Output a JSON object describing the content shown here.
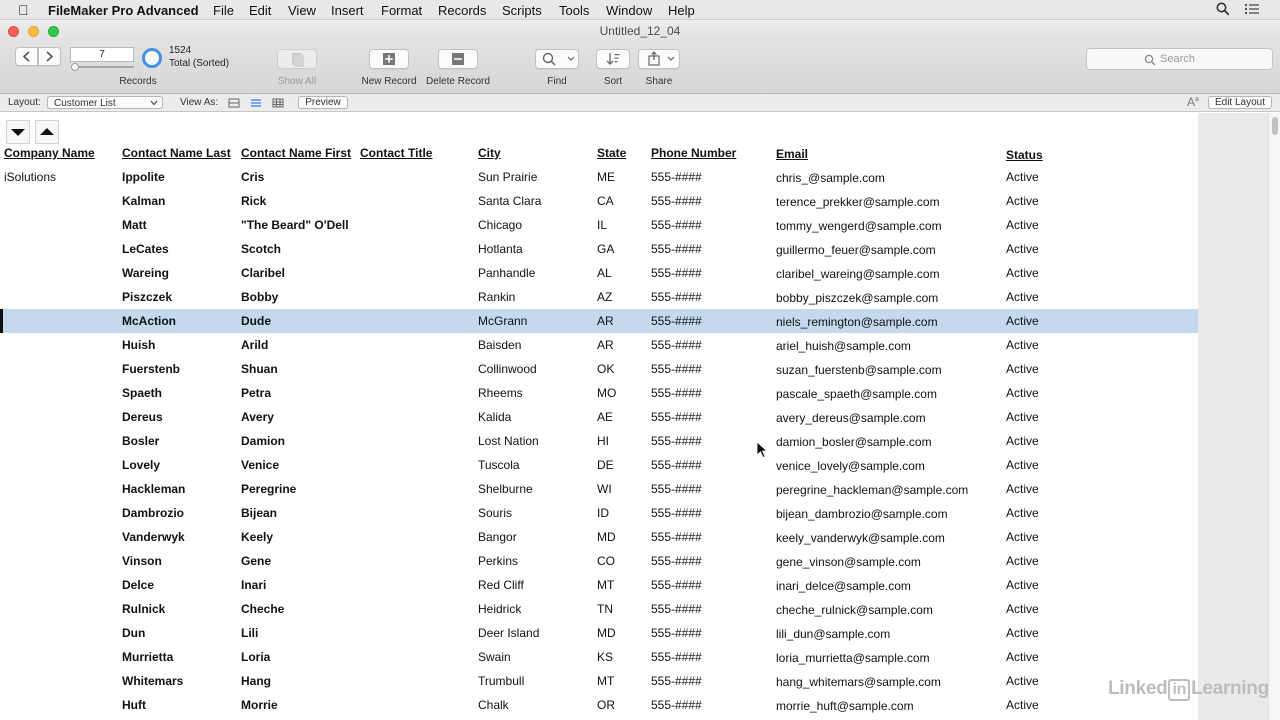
{
  "menubar": {
    "app_name": "FileMaker Pro Advanced",
    "items": [
      "File",
      "Edit",
      "View",
      "Insert",
      "Format",
      "Records",
      "Scripts",
      "Tools",
      "Window",
      "Help"
    ]
  },
  "window": {
    "title": "Untitled_12_04"
  },
  "toolbar": {
    "record_value": "7",
    "record_count": "1524",
    "record_status": "Total (Sorted)",
    "records_label": "Records",
    "show_all_label": "Show All",
    "new_record_label": "New Record",
    "delete_record_label": "Delete Record",
    "find_label": "Find",
    "sort_label": "Sort",
    "share_label": "Share",
    "search_placeholder": "Search"
  },
  "layoutbar": {
    "layout_label": "Layout:",
    "layout_value": "Customer List",
    "view_as_label": "View As:",
    "preview_label": "Preview",
    "edit_layout_label": "Edit Layout"
  },
  "table": {
    "columns": [
      {
        "key": "company",
        "label": "Company Name"
      },
      {
        "key": "last",
        "label": "Contact Name Last"
      },
      {
        "key": "first",
        "label": "Contact Name First"
      },
      {
        "key": "title",
        "label": "Contact Title"
      },
      {
        "key": "city",
        "label": "City"
      },
      {
        "key": "state",
        "label": "State"
      },
      {
        "key": "phone",
        "label": "Phone Number"
      },
      {
        "key": "email",
        "label": "Email"
      },
      {
        "key": "status",
        "label": "Status"
      }
    ],
    "selected_index": 6,
    "rows": [
      {
        "company": "iSolutions",
        "last": "Ippolite",
        "first": "Cris",
        "title": "",
        "city": "Sun Prairie",
        "state": "ME",
        "phone": "555-####",
        "email": "chris_@sample.com",
        "status": "Active"
      },
      {
        "company": "",
        "last": "Kalman",
        "first": "Rick",
        "title": "",
        "city": "Santa Clara",
        "state": "CA",
        "phone": "555-####",
        "email": "terence_prekker@sample.com",
        "status": "Active"
      },
      {
        "company": "",
        "last": "Matt",
        "first": "\"The Beard\" O'Dell",
        "title": "",
        "city": "Chicago",
        "state": "IL",
        "phone": "555-####",
        "email": "tommy_wengerd@sample.com",
        "status": "Active"
      },
      {
        "company": "",
        "last": "LeCates",
        "first": "Scotch",
        "title": "",
        "city": "Hotlanta",
        "state": "GA",
        "phone": "555-####",
        "email": "guillermo_feuer@sample.com",
        "status": "Active"
      },
      {
        "company": "",
        "last": "Wareing",
        "first": "Claribel",
        "title": "",
        "city": "Panhandle",
        "state": "AL",
        "phone": "555-####",
        "email": "claribel_wareing@sample.com",
        "status": "Active"
      },
      {
        "company": "",
        "last": "Piszczek",
        "first": "Bobby",
        "title": "",
        "city": "Rankin",
        "state": "AZ",
        "phone": "555-####",
        "email": "bobby_piszczek@sample.com",
        "status": "Active"
      },
      {
        "company": "",
        "last": "McAction",
        "first": "Dude",
        "title": "",
        "city": "McGrann",
        "state": "AR",
        "phone": "555-####",
        "email": "niels_remington@sample.com",
        "status": "Active"
      },
      {
        "company": "",
        "last": "Huish",
        "first": "Arild",
        "title": "",
        "city": "Baisden",
        "state": "AR",
        "phone": "555-####",
        "email": "ariel_huish@sample.com",
        "status": "Active"
      },
      {
        "company": "",
        "last": "Fuerstenb",
        "first": "Shuan",
        "title": "",
        "city": "Collinwood",
        "state": "OK",
        "phone": "555-####",
        "email": "suzan_fuerstenb@sample.com",
        "status": "Active"
      },
      {
        "company": "",
        "last": "Spaeth",
        "first": "Petra",
        "title": "",
        "city": "Rheems",
        "state": "MO",
        "phone": "555-####",
        "email": "pascale_spaeth@sample.com",
        "status": "Active"
      },
      {
        "company": "",
        "last": "Dereus",
        "first": "Avery",
        "title": "",
        "city": "Kalida",
        "state": "AE",
        "phone": "555-####",
        "email": "avery_dereus@sample.com",
        "status": "Active"
      },
      {
        "company": "",
        "last": "Bosler",
        "first": "Damion",
        "title": "",
        "city": "Lost Nation",
        "state": "HI",
        "phone": "555-####",
        "email": "damion_bosler@sample.com",
        "status": "Active"
      },
      {
        "company": "",
        "last": "Lovely",
        "first": "Venice",
        "title": "",
        "city": "Tuscola",
        "state": "DE",
        "phone": "555-####",
        "email": "venice_lovely@sample.com",
        "status": "Active"
      },
      {
        "company": "",
        "last": "Hackleman",
        "first": "Peregrine",
        "title": "",
        "city": "Shelburne",
        "state": "WI",
        "phone": "555-####",
        "email": "peregrine_hackleman@sample.com",
        "status": "Active"
      },
      {
        "company": "",
        "last": "Dambrozio",
        "first": "Bijean",
        "title": "",
        "city": "Souris",
        "state": "ID",
        "phone": "555-####",
        "email": "bijean_dambrozio@sample.com",
        "status": "Active"
      },
      {
        "company": "",
        "last": "Vanderwyk",
        "first": "Keely",
        "title": "",
        "city": "Bangor",
        "state": "MD",
        "phone": "555-####",
        "email": "keely_vanderwyk@sample.com",
        "status": "Active"
      },
      {
        "company": "",
        "last": "Vinson",
        "first": "Gene",
        "title": "",
        "city": "Perkins",
        "state": "CO",
        "phone": "555-####",
        "email": "gene_vinson@sample.com",
        "status": "Active"
      },
      {
        "company": "",
        "last": "Delce",
        "first": "Inari",
        "title": "",
        "city": "Red Cliff",
        "state": "MT",
        "phone": "555-####",
        "email": "inari_delce@sample.com",
        "status": "Active"
      },
      {
        "company": "",
        "last": "Rulnick",
        "first": "Cheche",
        "title": "",
        "city": "Heidrick",
        "state": "TN",
        "phone": "555-####",
        "email": "cheche_rulnick@sample.com",
        "status": "Active"
      },
      {
        "company": "",
        "last": "Dun",
        "first": "Lili",
        "title": "",
        "city": "Deer Island",
        "state": "MD",
        "phone": "555-####",
        "email": "lili_dun@sample.com",
        "status": "Active"
      },
      {
        "company": "",
        "last": "Murrietta",
        "first": "Loria",
        "title": "",
        "city": "Swain",
        "state": "KS",
        "phone": "555-####",
        "email": "loria_murrietta@sample.com",
        "status": "Active"
      },
      {
        "company": "",
        "last": "Whitemars",
        "first": "Hang",
        "title": "",
        "city": "Trumbull",
        "state": "MT",
        "phone": "555-####",
        "email": "hang_whitemars@sample.com",
        "status": "Active"
      },
      {
        "company": "",
        "last": "Huft",
        "first": "Morrie",
        "title": "",
        "city": "Chalk",
        "state": "OR",
        "phone": "555-####",
        "email": "morrie_huft@sample.com",
        "status": "Active"
      }
    ]
  },
  "watermark": {
    "part1": "Linked",
    "part2": "in",
    "part3": "Learning"
  },
  "icons": [
    "apple-icon",
    "search-icon",
    "list-menu-icon",
    "back-arrow-icon",
    "forward-arrow-icon",
    "pie-icon",
    "magnifier-icon",
    "sort-icon",
    "share-icon",
    "sort-descending-icon",
    "sort-ascending-icon",
    "cursor-icon"
  ],
  "colors": {
    "selection": "#c5d9ee",
    "close": "#fc605c",
    "minimize": "#fdbc40",
    "zoom": "#34c84a",
    "accent": "#3478f6"
  }
}
